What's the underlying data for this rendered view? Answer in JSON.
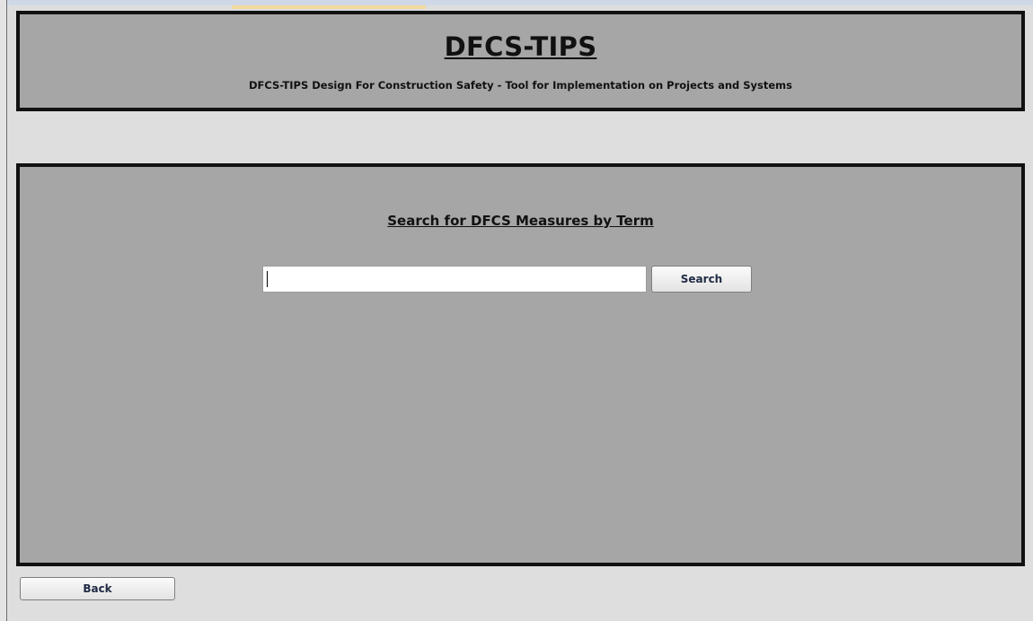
{
  "header": {
    "title": "DFCS-TIPS",
    "subtitle": "DFCS-TIPS Design For Construction Safety - Tool for Implementation on Projects and Systems"
  },
  "search": {
    "heading": "Search for DFCS Measures by Term",
    "value": "",
    "placeholder": "",
    "button_label": "Search"
  },
  "footer": {
    "back_label": "Back"
  },
  "colors": {
    "panel": "#a6a6a6",
    "background": "#dedede",
    "border": "#111111"
  }
}
